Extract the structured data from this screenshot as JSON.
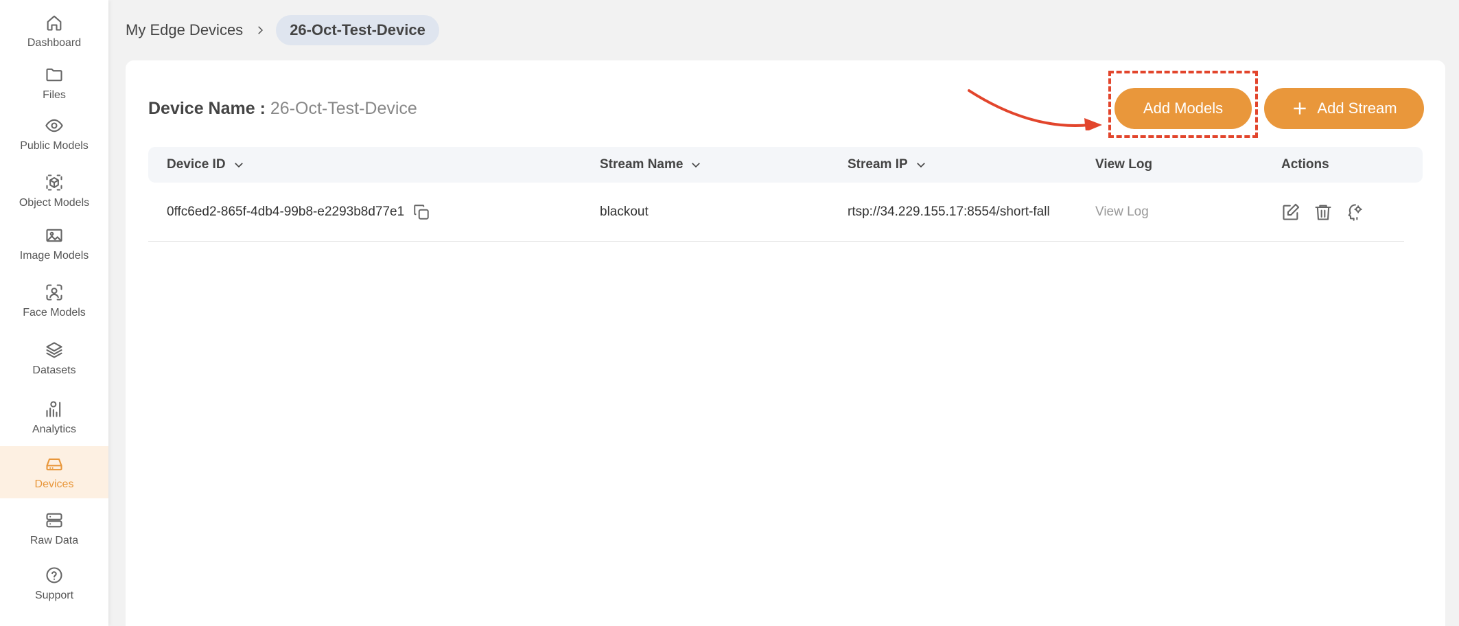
{
  "sidebar": {
    "items": [
      {
        "label": "Dashboard",
        "icon": "home-icon"
      },
      {
        "label": "Files",
        "icon": "folder-icon"
      },
      {
        "label": "Public Models",
        "icon": "eye-icon"
      },
      {
        "label": "Object Models",
        "icon": "cube-icon"
      },
      {
        "label": "Image Models",
        "icon": "image-icon"
      },
      {
        "label": "Face Models",
        "icon": "face-scan-icon"
      },
      {
        "label": "Datasets",
        "icon": "layers-icon"
      },
      {
        "label": "Analytics",
        "icon": "analytics-icon"
      },
      {
        "label": "Devices",
        "icon": "drive-icon",
        "active": true
      },
      {
        "label": "Raw Data",
        "icon": "server-icon"
      },
      {
        "label": "Support",
        "icon": "help-circle-icon"
      }
    ]
  },
  "breadcrumb": {
    "parent": "My Edge Devices",
    "current": "26-Oct-Test-Device"
  },
  "device": {
    "name_key": "Device Name :",
    "name_value": "26-Oct-Test-Device"
  },
  "actions": {
    "add_models": "Add Models",
    "add_stream": "Add Stream"
  },
  "table": {
    "headers": {
      "device_id": "Device ID",
      "stream_name": "Stream Name",
      "stream_ip": "Stream IP",
      "view_log": "View Log",
      "actions": "Actions"
    },
    "rows": [
      {
        "device_id": "0ffc6ed2-865f-4db4-99b8-e2293b8d77e1",
        "stream_name": "blackout",
        "stream_ip": "rtsp://34.229.155.17:8554/short-fall",
        "view_log": "View Log"
      }
    ]
  },
  "colors": {
    "accent": "#e9973b",
    "highlight": "#e2452c",
    "active_bg": "#fdf0e2"
  }
}
